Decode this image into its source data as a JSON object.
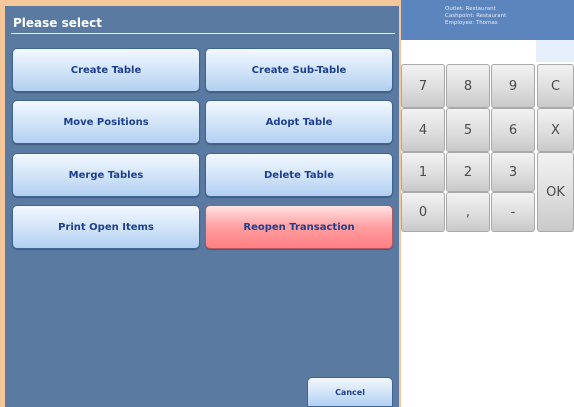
{
  "dialog": {
    "title": "Please select",
    "buttons": {
      "create_table": "Create Table",
      "create_sub_table": "Create Sub-Table",
      "move_positions": "Move Positions",
      "adopt_table": "Adopt Table",
      "merge_tables": "Merge Tables",
      "delete_table": "Delete Table",
      "print_open_items": "Print Open Items",
      "reopen_transaction": "Reopen Transaction"
    },
    "cancel": "Cancel"
  },
  "info": {
    "outlet": "Outlet: Restaurant",
    "cashpoint": "Cashpoint: Restaurant",
    "employee": "Employee: Thomas"
  },
  "keypad": {
    "k7": "7",
    "k8": "8",
    "k9": "9",
    "clear": "C",
    "k4": "4",
    "k5": "5",
    "k6": "6",
    "delete": "X",
    "k1": "1",
    "k2": "2",
    "k3": "3",
    "ok": "OK",
    "k0": "0",
    "comma": ",",
    "minus": "-"
  },
  "colors": {
    "dialog_bg": "#5a7aa2",
    "button_text": "#1e3f8f",
    "reopen_button": "#ff8f93",
    "info_bg": "#5c84bd",
    "page_bg": "#f4c89a"
  }
}
